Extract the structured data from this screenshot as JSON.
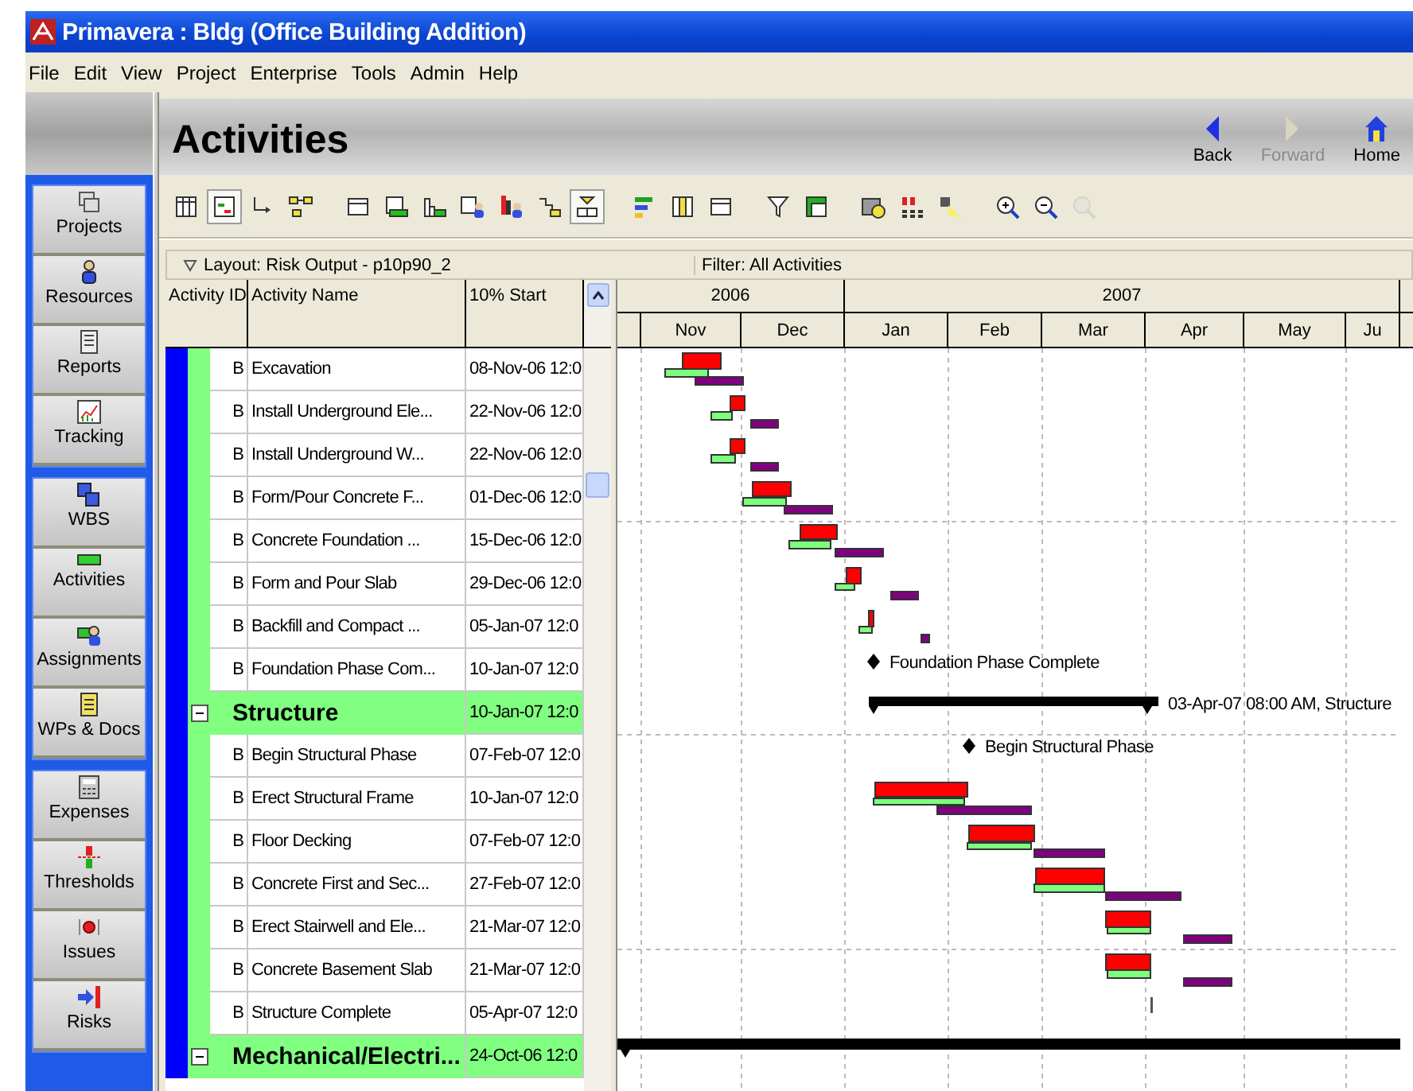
{
  "window": {
    "title": "Primavera : Bldg (Office Building Addition)"
  },
  "menu": [
    "File",
    "Edit",
    "View",
    "Project",
    "Enterprise",
    "Tools",
    "Admin",
    "Help"
  ],
  "sidebar": {
    "groups": [
      {
        "items": [
          {
            "label": "Projects",
            "kind": "folders"
          },
          {
            "label": "Resources",
            "kind": "person"
          },
          {
            "label": "Reports",
            "kind": "report"
          },
          {
            "label": "Tracking",
            "kind": "chart"
          }
        ]
      },
      {
        "items": [
          {
            "label": "WBS",
            "kind": "blocks"
          },
          {
            "label": "Activities",
            "kind": "bar"
          },
          {
            "label": "Assignments",
            "kind": "people"
          },
          {
            "label": "WPs & Docs",
            "kind": "page"
          }
        ]
      },
      {
        "items": [
          {
            "label": "Expenses",
            "kind": "calculator"
          },
          {
            "label": "Thresholds",
            "kind": "meter"
          },
          {
            "label": "Issues",
            "kind": "dot"
          },
          {
            "label": "Risks",
            "kind": "arrow"
          }
        ]
      }
    ]
  },
  "header": {
    "title": "Activities",
    "nav": [
      {
        "label": "Back",
        "kind": "back",
        "disabled": false
      },
      {
        "label": "Forward",
        "kind": "forward",
        "disabled": true
      },
      {
        "label": "Home",
        "kind": "home",
        "disabled": false
      }
    ]
  },
  "toolbar": [
    {
      "kind": "table",
      "selected": false,
      "disabled": false
    },
    {
      "kind": "gantt",
      "selected": true,
      "disabled": false
    },
    {
      "kind": "elbow",
      "selected": false,
      "disabled": false
    },
    {
      "kind": "network",
      "selected": false,
      "disabled": false
    },
    {
      "kind": "window",
      "selected": false,
      "disabled": false
    },
    {
      "kind": "tablebar",
      "selected": false,
      "disabled": false
    },
    {
      "kind": "histogram",
      "selected": false,
      "disabled": false
    },
    {
      "kind": "tableperson",
      "selected": false,
      "disabled": false
    },
    {
      "kind": "barsperson",
      "selected": false,
      "disabled": false
    },
    {
      "kind": "steps",
      "selected": false,
      "disabled": false
    },
    {
      "kind": "boxes",
      "selected": true,
      "disabled": false
    },
    {
      "kind": "colorbars",
      "selected": false,
      "disabled": false
    },
    {
      "kind": "columns",
      "selected": false,
      "disabled": false
    },
    {
      "kind": "window",
      "selected": false,
      "disabled": false
    },
    {
      "kind": "funnel",
      "selected": false,
      "disabled": false
    },
    {
      "kind": "greenwindow",
      "selected": false,
      "disabled": false
    },
    {
      "kind": "folderclock",
      "selected": false,
      "disabled": false
    },
    {
      "kind": "grid",
      "selected": false,
      "disabled": false
    },
    {
      "kind": "flashlight",
      "selected": false,
      "disabled": false
    },
    {
      "kind": "zoomin",
      "selected": false,
      "disabled": false
    },
    {
      "kind": "zoomout",
      "selected": false,
      "disabled": false
    },
    {
      "kind": "zoomfit",
      "selected": false,
      "disabled": true
    }
  ],
  "layout_bar": {
    "layout": "Layout: Risk Output - p10p90_2",
    "filter": "Filter: All Activities"
  },
  "table": {
    "columns": [
      "Activity ID",
      "Activity Name",
      "10% Start"
    ],
    "rows": [
      {
        "kind": "activity",
        "id": "B",
        "name": "Excavation",
        "start": "08-Nov-06 12:0"
      },
      {
        "kind": "activity",
        "id": "B",
        "name": "Install Underground Ele...",
        "start": "22-Nov-06 12:0"
      },
      {
        "kind": "activity",
        "id": "B",
        "name": "Install Underground W...",
        "start": "22-Nov-06 12:0"
      },
      {
        "kind": "activity",
        "id": "B",
        "name": "Form/Pour Concrete F...",
        "start": "01-Dec-06 12:0"
      },
      {
        "kind": "activity",
        "id": "B",
        "name": "Concrete Foundation ...",
        "start": "15-Dec-06 12:0"
      },
      {
        "kind": "activity",
        "id": "B",
        "name": "Form and Pour Slab",
        "start": "29-Dec-06 12:0"
      },
      {
        "kind": "activity",
        "id": "B",
        "name": "Backfill and Compact ...",
        "start": "05-Jan-07 12:0"
      },
      {
        "kind": "activity",
        "id": "B",
        "name": "Foundation Phase Com...",
        "start": "10-Jan-07 12:0"
      },
      {
        "kind": "wbs",
        "name": "Structure",
        "start": "10-Jan-07 12:0",
        "expanded": true
      },
      {
        "kind": "activity",
        "id": "B",
        "name": "Begin Structural Phase",
        "start": "07-Feb-07 12:0"
      },
      {
        "kind": "activity",
        "id": "B",
        "name": "Erect Structural Frame",
        "start": "10-Jan-07 12:0"
      },
      {
        "kind": "activity",
        "id": "B",
        "name": "Floor Decking",
        "start": "07-Feb-07 12:0"
      },
      {
        "kind": "activity",
        "id": "B",
        "name": "Concrete First and Sec...",
        "start": "27-Feb-07 12:0"
      },
      {
        "kind": "activity",
        "id": "B",
        "name": "Erect Stairwell and Ele...",
        "start": "21-Mar-07 12:0"
      },
      {
        "kind": "activity",
        "id": "B",
        "name": "Concrete Basement Slab",
        "start": "21-Mar-07 12:0"
      },
      {
        "kind": "activity",
        "id": "B",
        "name": "Structure Complete",
        "start": "05-Apr-07 12:0"
      },
      {
        "kind": "wbs",
        "name": "Mechanical/Electri...",
        "start": "24-Oct-06 12:0",
        "expanded": true
      }
    ]
  },
  "gantt": {
    "years": [
      "2006",
      "2007"
    ],
    "months": [
      "Nov",
      "Dec",
      "Jan",
      "Feb",
      "Mar",
      "Apr",
      "May",
      "Ju"
    ],
    "labels": [
      {
        "kind": "milestone",
        "text": "Foundation Phase Complete"
      },
      {
        "kind": "summary",
        "text": "03-Apr-07 08:00 AM, Structure"
      },
      {
        "kind": "milestone",
        "text": "Begin Structural Phase"
      }
    ]
  }
}
